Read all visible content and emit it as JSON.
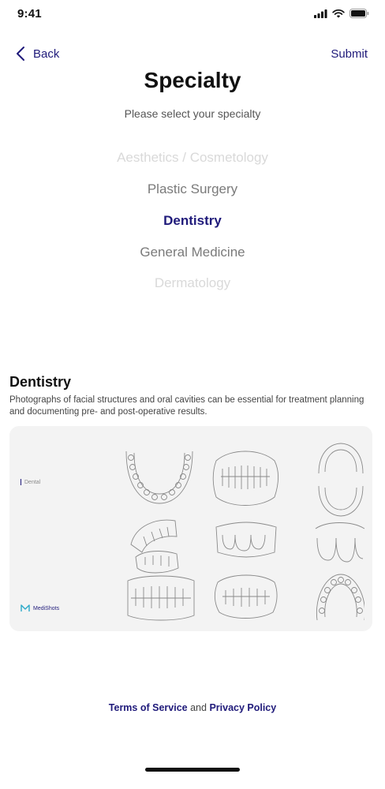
{
  "status_bar": {
    "time": "9:41"
  },
  "nav": {
    "back_label": "Back",
    "submit_label": "Submit"
  },
  "header": {
    "title": "Specialty",
    "subtitle": "Please select your specialty"
  },
  "picker": {
    "items": [
      {
        "label": "Aesthetics / Cosmetology",
        "state": "far"
      },
      {
        "label": "Plastic Surgery",
        "state": "near"
      },
      {
        "label": "Dentistry",
        "state": "selected"
      },
      {
        "label": "General Medicine",
        "state": "near"
      },
      {
        "label": "Dermatology",
        "state": "far"
      }
    ]
  },
  "detail": {
    "title": "Dentistry",
    "description": "Photographs of facial structures and oral cavities can be essential for treatment planning and documenting pre- and post-operative results.",
    "card_tag": "Dental",
    "card_brand": "MediShots"
  },
  "footer": {
    "terms_label": "Terms of Service",
    "and_label": "and",
    "privacy_label": "Privacy Policy"
  },
  "colors": {
    "accent": "#1f1a7a",
    "card_bg": "#f3f3f3"
  }
}
